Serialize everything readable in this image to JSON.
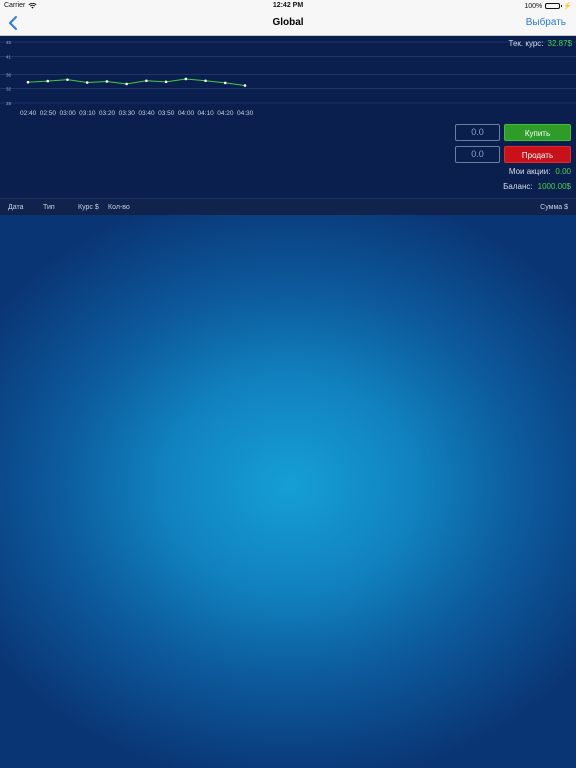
{
  "status_bar": {
    "carrier": "Carrier",
    "time": "12:42 PM",
    "battery": "100%"
  },
  "nav": {
    "title": "Global",
    "action": "Выбрать"
  },
  "current_rate": {
    "label": "Тек. курс:",
    "value": "32.87$"
  },
  "trading": {
    "buy_amount": "0.0",
    "sell_amount": "0.0",
    "buy_label": "Купить",
    "sell_label": "Продать"
  },
  "account": {
    "shares_label": "Мои акции:",
    "shares_value": "0.00",
    "balance_label": "Баланс:",
    "balance_value": "1000.00$"
  },
  "table": {
    "headers": [
      "Дата",
      "Тип",
      "Курс $",
      "Кол-во",
      "Сумма $"
    ]
  },
  "colors": {
    "accent": "#2a7ae2",
    "buy": "#2f9c2a",
    "sell": "#c9111a",
    "positive": "#48d14a",
    "line": "#3fcf3f"
  },
  "chart_data": {
    "type": "line",
    "x": [
      "02:40",
      "02:50",
      "03:00",
      "03:10",
      "03:20",
      "03:30",
      "03:40",
      "03:50",
      "04:00",
      "04:10",
      "04:20",
      "04:30"
    ],
    "series": [
      {
        "values": [
          33.8,
          34.1,
          34.5,
          33.7,
          34.0,
          33.3,
          34.2,
          33.9,
          34.7,
          34.2,
          33.6,
          32.87
        ]
      }
    ],
    "yticks": [
      28,
      32,
      36,
      41,
      45
    ],
    "ylim": [
      28,
      45
    ],
    "grid": true
  }
}
